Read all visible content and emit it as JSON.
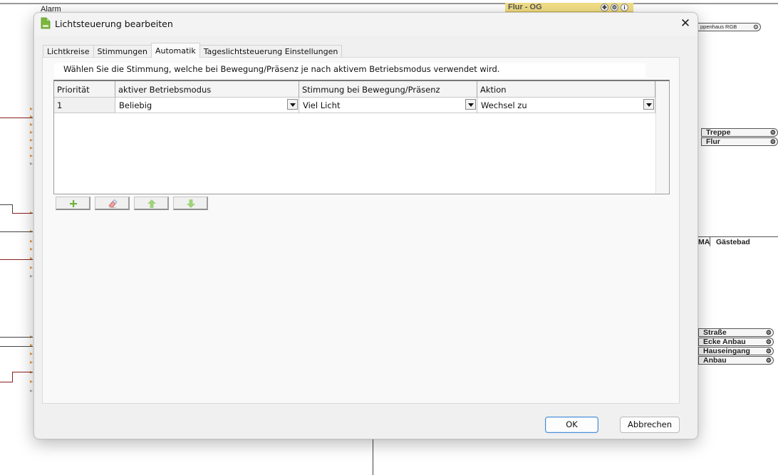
{
  "background": {
    "alarm_label": "Alarm",
    "flur_og": "Flur - OG",
    "treppenhaus_rgb": "ppenhaus RGB",
    "right_items_top": [
      "Treppe",
      "Flur"
    ],
    "ma_label": "MA",
    "gastebad": "Gästebad",
    "right_items_bottom": [
      "Straße",
      "Ecke Anbau",
      "Hauseingang",
      "Anbau"
    ]
  },
  "dialog": {
    "title": "Lichtsteuerung bearbeiten",
    "close_symbol": "✕",
    "tabs": [
      {
        "label": "Lichtkreise",
        "active": false
      },
      {
        "label": "Stimmungen",
        "active": false
      },
      {
        "label": "Automatik",
        "active": true
      },
      {
        "label": "Tageslichtsteuerung Einstellungen",
        "active": false
      }
    ],
    "description": "Wählen Sie die Stimmung, welche bei Bewegung/Präsenz je nach aktivem Betriebsmodus verwendet wird.",
    "table": {
      "headers": [
        "Priorität",
        "aktiver Betriebsmodus",
        "Stimmung bei Bewegung/Präsenz",
        "Aktion"
      ],
      "rows": [
        {
          "priority": "1",
          "mode": "Beliebig",
          "mood": "Viel Licht",
          "action": "Wechsel zu"
        }
      ]
    },
    "toolbar_icons": [
      "plus-icon",
      "eraser-icon",
      "arrow-up-icon",
      "arrow-down-icon"
    ],
    "ok_label": "OK",
    "cancel_label": "Abbrechen"
  },
  "colors": {
    "accent_green": "#7ab83a",
    "ok_border": "#4a8fd6",
    "flur_og_bg": "#f3df85"
  }
}
